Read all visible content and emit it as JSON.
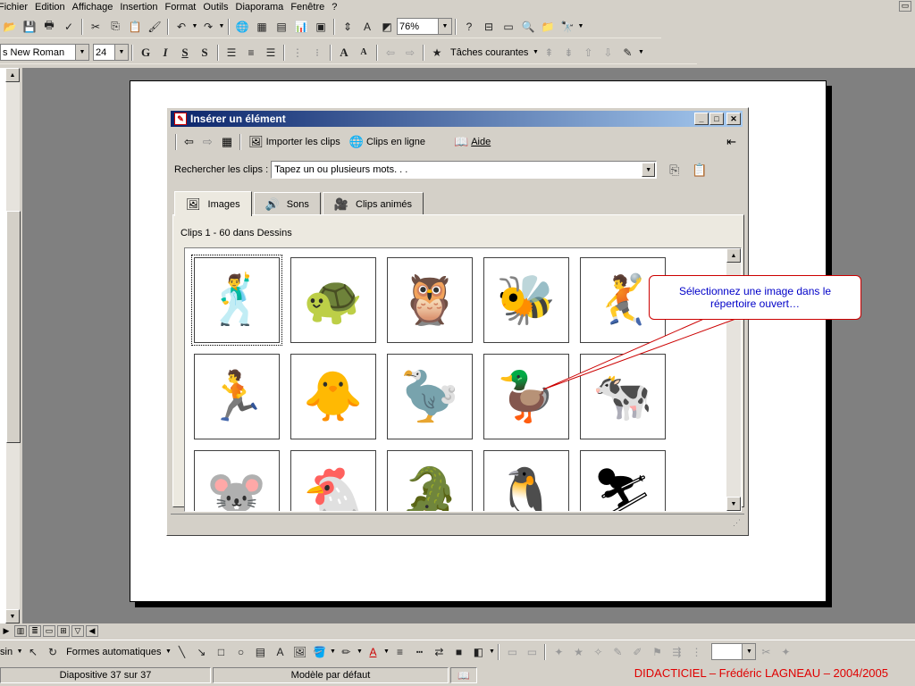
{
  "menu": [
    "Fichier",
    "Edition",
    "Affichage",
    "Insertion",
    "Format",
    "Outils",
    "Diaporama",
    "Fenêtre",
    "?"
  ],
  "standard_toolbar": {
    "zoom": "76%"
  },
  "format_toolbar": {
    "font": "s New Roman",
    "size": "24",
    "bold": "G",
    "italic": "I",
    "underline": "S",
    "shadow": "S",
    "tasks_label": "Tâches courantes"
  },
  "dialog": {
    "title": "Insérer un élément",
    "toolbar": {
      "import_label": "Importer les clips",
      "online_label": "Clips en ligne",
      "help_label": "Aide"
    },
    "search": {
      "label": "Rechercher les clips :",
      "value": "Tapez un ou plusieurs mots. . ."
    },
    "tabs": [
      {
        "label": "Images",
        "active": true,
        "icon": "images-icon"
      },
      {
        "label": "Sons",
        "active": false,
        "icon": "sound-icon"
      },
      {
        "label": "Clips animés",
        "active": false,
        "icon": "video-camera-icon"
      }
    ],
    "clips_count": "Clips 1 - 60 dans Dessins",
    "clips": [
      {
        "icon": "🕺",
        "name": "dancing-man-clip",
        "selected": true
      },
      {
        "icon": "🐢",
        "name": "turtle-reading-clip"
      },
      {
        "icon": "🦉",
        "name": "owl-reading-clip"
      },
      {
        "icon": "🐝",
        "name": "bee-robot-clip"
      },
      {
        "icon": "🤾",
        "name": "jumping-man-clip"
      },
      {
        "icon": "🏃",
        "name": "running-man-clip"
      },
      {
        "icon": "🐥",
        "name": "duckling-clip"
      },
      {
        "icon": "🦤",
        "name": "ostrich-clip"
      },
      {
        "icon": "🦆",
        "name": "duck-clip"
      },
      {
        "icon": "🐄",
        "name": "upside-down-animal-clip"
      },
      {
        "icon": "🐭",
        "name": "mouse-hat-clip"
      },
      {
        "icon": "🐔",
        "name": "chicken-clip"
      },
      {
        "icon": "🐊",
        "name": "crocodile-clip"
      },
      {
        "icon": "🐧",
        "name": "penguin-ski-clip"
      },
      {
        "icon": "⛷",
        "name": "skier-clip"
      }
    ]
  },
  "callout": {
    "text": "Sélectionnez une image dans le répertoire ouvert…"
  },
  "drawing_toolbar": {
    "draw_label": "sin",
    "autoshapes_label": "Formes automatiques"
  },
  "status": {
    "slide": "Diapositive 37 sur 37",
    "template": "Modèle par défaut",
    "credit": "DIDACTICIEL – Frédéric LAGNEAU – 2004/2005"
  }
}
